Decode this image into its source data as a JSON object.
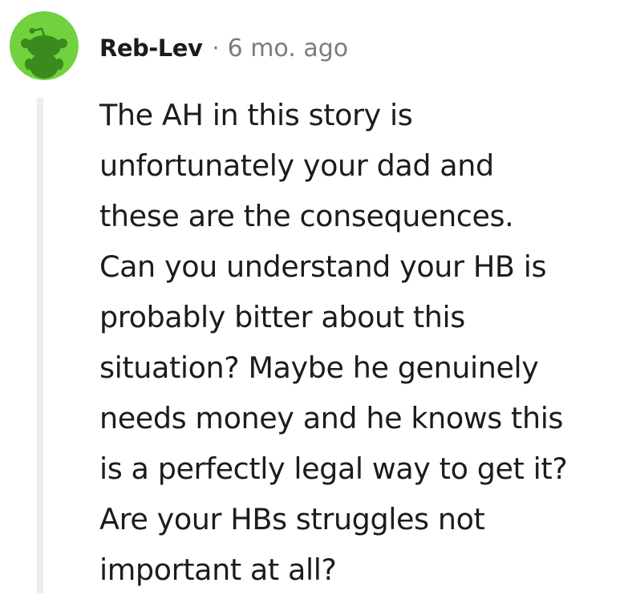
{
  "comment": {
    "avatar_icon": "reddit-snoo-icon",
    "avatar_color": "#71d13e",
    "username": "Reb-Lev",
    "separator": "·",
    "timestamp": "6 mo. ago",
    "body_lines": [
      "The AH in this story is",
      "unfortunately your dad and",
      "these are the consequences.",
      "Can you understand your HB is",
      "probably bitter about this",
      "situation? Maybe he genuinely",
      "needs money and he knows this",
      "is a perfectly legal way to get it?",
      "Are your HBs struggles not",
      "important at all?"
    ]
  }
}
